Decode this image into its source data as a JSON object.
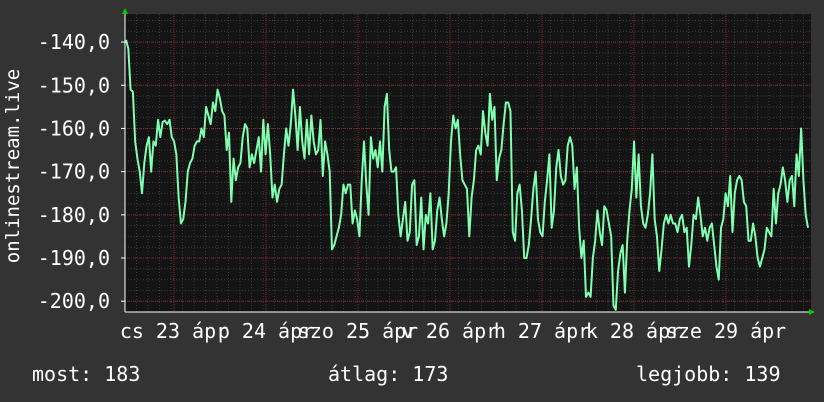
{
  "chart_data": {
    "type": "line",
    "ylabel": "onlinestream.live",
    "ylim": [
      -202.5,
      -133.5
    ],
    "yticks": [
      -140,
      -150,
      -160,
      -170,
      -180,
      -190,
      -200
    ],
    "ytick_labels": [
      "-140,0",
      "-150,0",
      "-160,0",
      "-170,0",
      "-180,0",
      "-190,0",
      "-200,0"
    ],
    "xtick_labels": [
      "cs 23 ápr",
      "p 24 ápr",
      "szo 25 ápr",
      "v 26 ápr",
      "h 27 ápr",
      "k 28 ápr",
      "sze 29 ápr"
    ],
    "grid": true,
    "colors": {
      "line": "#80ffb0",
      "grid": "#7a2a2a",
      "plot_bg": "#141414",
      "axis": "#ffffff",
      "arrow": "#00cc00"
    },
    "series": [
      {
        "values": [
          -139.5,
          -141.5,
          -151,
          -151.5,
          -163,
          -167,
          -170,
          -175,
          -168,
          -164,
          -162,
          -170,
          -163,
          -164,
          -158,
          -162,
          -158.5,
          -158.2,
          -159,
          -158,
          -162,
          -163,
          -166,
          -176,
          -182,
          -181,
          -177,
          -170,
          -168,
          -167,
          -164,
          -163,
          -163,
          -160,
          -162,
          -155,
          -157,
          -159,
          -154,
          -156,
          -151,
          -153,
          -156,
          -157,
          -165,
          -161,
          -177,
          -167,
          -172,
          -169,
          -168,
          -162,
          -159,
          -160,
          -169,
          -166,
          -168,
          -165,
          -162,
          -170,
          -158,
          -166,
          -159,
          -166,
          -176,
          -173,
          -177,
          -174,
          -173,
          -166,
          -160,
          -164,
          -159,
          -151,
          -157,
          -165,
          -155,
          -163,
          -167,
          -158,
          -166,
          -157,
          -163,
          -166,
          -165,
          -158,
          -171,
          -163,
          -166,
          -170,
          -188,
          -187,
          -185,
          -183,
          -180,
          -173,
          -175,
          -173,
          -173,
          -182,
          -179,
          -181,
          -185,
          -172,
          -163,
          -173,
          -180,
          -162,
          -167,
          -165,
          -169,
          -163,
          -170,
          -155,
          -152,
          -165,
          -170,
          -170,
          -169,
          -180,
          -185,
          -181,
          -177,
          -186,
          -184,
          -173,
          -172,
          -187,
          -185,
          -176,
          -188,
          -180,
          -182,
          -175,
          -188,
          -186,
          -179,
          -176,
          -181,
          -185,
          -182,
          -175,
          -163,
          -157,
          -160,
          -158,
          -166,
          -172,
          -173,
          -174,
          -185,
          -176,
          -172,
          -165,
          -164,
          -166,
          -156,
          -161,
          -164,
          -152,
          -158,
          -155,
          -172,
          -167,
          -165,
          -159,
          -154,
          -154,
          -156,
          -184,
          -186,
          -175,
          -173,
          -179,
          -190,
          -190,
          -187,
          -181,
          -174,
          -170,
          -181,
          -184,
          -185,
          -177,
          -172,
          -166,
          -183,
          -179,
          -169,
          -165,
          -171,
          -173,
          -172,
          -164,
          -162,
          -164,
          -174,
          -169,
          -183,
          -190,
          -186,
          -199,
          -198,
          -199,
          -190,
          -186,
          -179,
          -184,
          -187,
          -178,
          -179,
          -182,
          -185,
          -201,
          -202,
          -193,
          -189,
          -187,
          -198,
          -186,
          -179,
          -174,
          -163,
          -176,
          -166,
          -178,
          -182,
          -183,
          -180,
          -175,
          -166,
          -181,
          -185,
          -193,
          -188,
          -182,
          -180,
          -182,
          -180,
          -182,
          -182,
          -184,
          -181,
          -180,
          -184,
          -183,
          -192,
          -187,
          -180,
          -181,
          -176,
          -180,
          -185,
          -183,
          -186,
          -183,
          -182,
          -187,
          -192,
          -195,
          -183,
          -181,
          -175,
          -178,
          -171,
          -184,
          -175,
          -172,
          -171,
          -172,
          -177,
          -178,
          -186,
          -186,
          -182,
          -185,
          -190,
          -192,
          -190,
          -188,
          -183,
          -184,
          -185,
          -174,
          -182,
          -175,
          -173,
          -169,
          -172,
          -177,
          -172,
          -171,
          -178,
          -166,
          -171,
          -160,
          -172,
          -180,
          -183
        ]
      }
    ]
  },
  "footer": {
    "current": "most: 183",
    "average": "átlag: 173",
    "best": "legjobb: 139"
  }
}
